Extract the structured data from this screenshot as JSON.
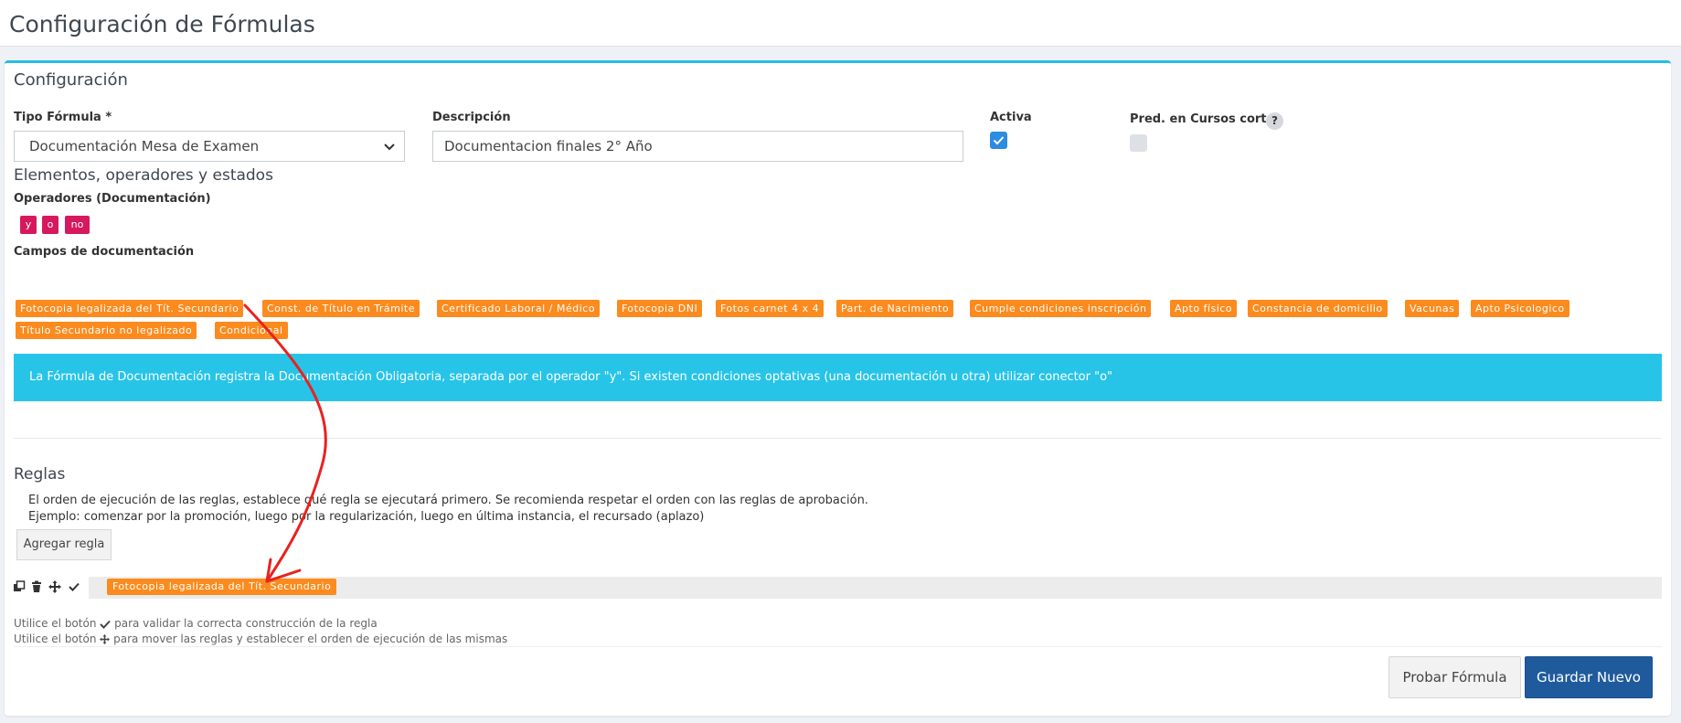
{
  "page": {
    "title": "Configuración de Fórmulas"
  },
  "config": {
    "section_title": "Configuración",
    "tipo_label": "Tipo Fórmula *",
    "tipo_value": "Documentación Mesa de Examen",
    "descripcion_label": "Descripción",
    "descripcion_value": "Documentacion finales 2° Año",
    "activa_label": "Activa",
    "activa_checked": true,
    "pred_label": "Pred. en Cursos cortos",
    "pred_checked": false,
    "help_badge": "?"
  },
  "elements": {
    "section_title": "Elementos, operadores y estados",
    "operators_label": "Operadores (Documentación)",
    "operators": [
      "y",
      "o",
      "no"
    ],
    "fields_label": "Campos de documentación",
    "fields": [
      "Fotocopia legalizada del Tít. Secundario",
      "Const. de Título en Trámite",
      "Certificado Laboral / Médico",
      "Fotocopia DNI",
      "Fotos carnet 4 x 4",
      "Part. de Nacimiento",
      "Cumple condiciones inscripción",
      "Apto físico",
      "Constancia de domicilio",
      "Vacunas",
      "Apto Psicologico",
      "Título Secundario no legalizado",
      "Condicional"
    ],
    "info_text": "La Fórmula de Documentación registra la Documentación Obligatoria, separada por el operador \"y\". Si existen condiciones optativas (una documentación u otra) utilizar conector \"o\""
  },
  "rules": {
    "section_title": "Reglas",
    "description_line1": "El orden de ejecución de las reglas, establece qué regla se ejecutará primero. Se recomienda respetar el orden con las reglas de aprobación.",
    "description_line2": "Ejemplo: comenzar por la promoción, luego por la regularización, luego en última instancia, el recursado (aplazo)",
    "add_button": "Agregar regla",
    "rule_items": [
      "Fotocopia legalizada del Tít. Secundario"
    ],
    "note_validate_pre": "Utilice el botón",
    "note_validate_post": "para validar la correcta construcción de la regla",
    "note_move_pre": "Utilice el botón",
    "note_move_post": "para mover las reglas y establecer el orden de ejecución de las mismas"
  },
  "footer": {
    "test_button": "Probar Fórmula",
    "save_button": "Guardar Nuevo"
  },
  "colors": {
    "accent": "#27bde5",
    "operator": "#d6195e",
    "field_tag": "#fb8b1e",
    "primary_button": "#1f5b9c",
    "checkbox_checked": "#2d8ce0",
    "annotation_arrow": "#e8221f"
  }
}
